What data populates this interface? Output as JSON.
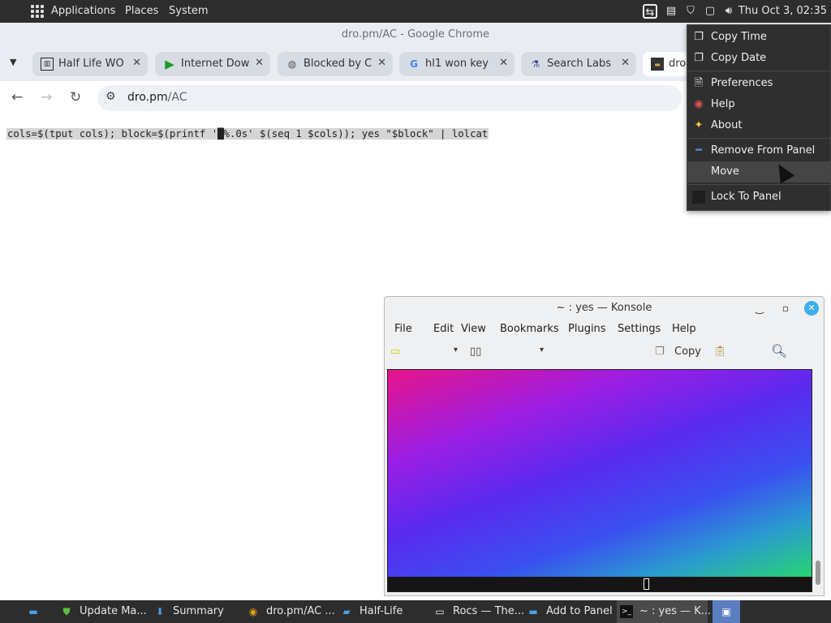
{
  "panel": {
    "menus": [
      "Applications",
      "Places",
      "System"
    ],
    "clock": "Thu Oct 3, 02:35",
    "tray_icons": [
      "update-icon",
      "clipboard-icon",
      "shield-icon",
      "window-icon",
      "volume-icon"
    ]
  },
  "chrome": {
    "window_title": "dro.pm/AC - Google Chrome",
    "tabs": [
      {
        "title": "Half Life WO",
        "icon": "columns-icon"
      },
      {
        "title": "Internet Dow",
        "icon": "play-icon"
      },
      {
        "title": "Blocked by C",
        "icon": "globe-icon"
      },
      {
        "title": "hl1 won key",
        "icon": "google-icon"
      },
      {
        "title": "Search Labs",
        "icon": "flask-icon"
      },
      {
        "title": "dro.",
        "icon": "terminal-icon"
      }
    ],
    "url_host": "dro.pm",
    "url_path": "/AC",
    "page_code_before": "cols=$(tput cols); block=$(printf '",
    "page_code_block": "█",
    "page_code_after": "%.0s' $(seq 1 $cols)); yes \"$block\" | lolcat"
  },
  "context_menu": {
    "items": [
      {
        "label": "Copy Time",
        "icon": "copy-icon"
      },
      {
        "label": "Copy Date",
        "icon": "copy-icon"
      },
      {
        "label": "Preferences",
        "icon": "document-icon"
      },
      {
        "label": "Help",
        "icon": "lifebuoy-icon"
      },
      {
        "label": "About",
        "icon": "star-icon"
      },
      {
        "label": "Remove From Panel",
        "icon": "minus-icon"
      },
      {
        "label": "Move",
        "icon": ""
      },
      {
        "label": "Lock To Panel",
        "icon": "lock-box-icon"
      }
    ]
  },
  "konsole": {
    "title": "~ : yes — Konsole",
    "menus": [
      "File",
      "Edit",
      "View",
      "Bookmarks",
      "Plugins",
      "Settings",
      "Help"
    ],
    "toolbar_copy": "Copy"
  },
  "taskbar": {
    "items": [
      {
        "label": "",
        "icon": "desktop-icon"
      },
      {
        "label": "Update Ma...",
        "icon": "shield-icon"
      },
      {
        "label": "Summary",
        "icon": "download-icon"
      },
      {
        "label": "dro.pm/AC ...",
        "icon": "chrome-icon"
      },
      {
        "label": "Half-Life",
        "icon": "folder-icon"
      },
      {
        "label": "Rocs — The...",
        "icon": "window-icon"
      },
      {
        "label": "Add to Panel",
        "icon": "panel-icon"
      },
      {
        "label": "~ : yes — K...",
        "icon": "terminal-icon"
      },
      {
        "label": "",
        "icon": "screenshot-icon"
      }
    ]
  }
}
